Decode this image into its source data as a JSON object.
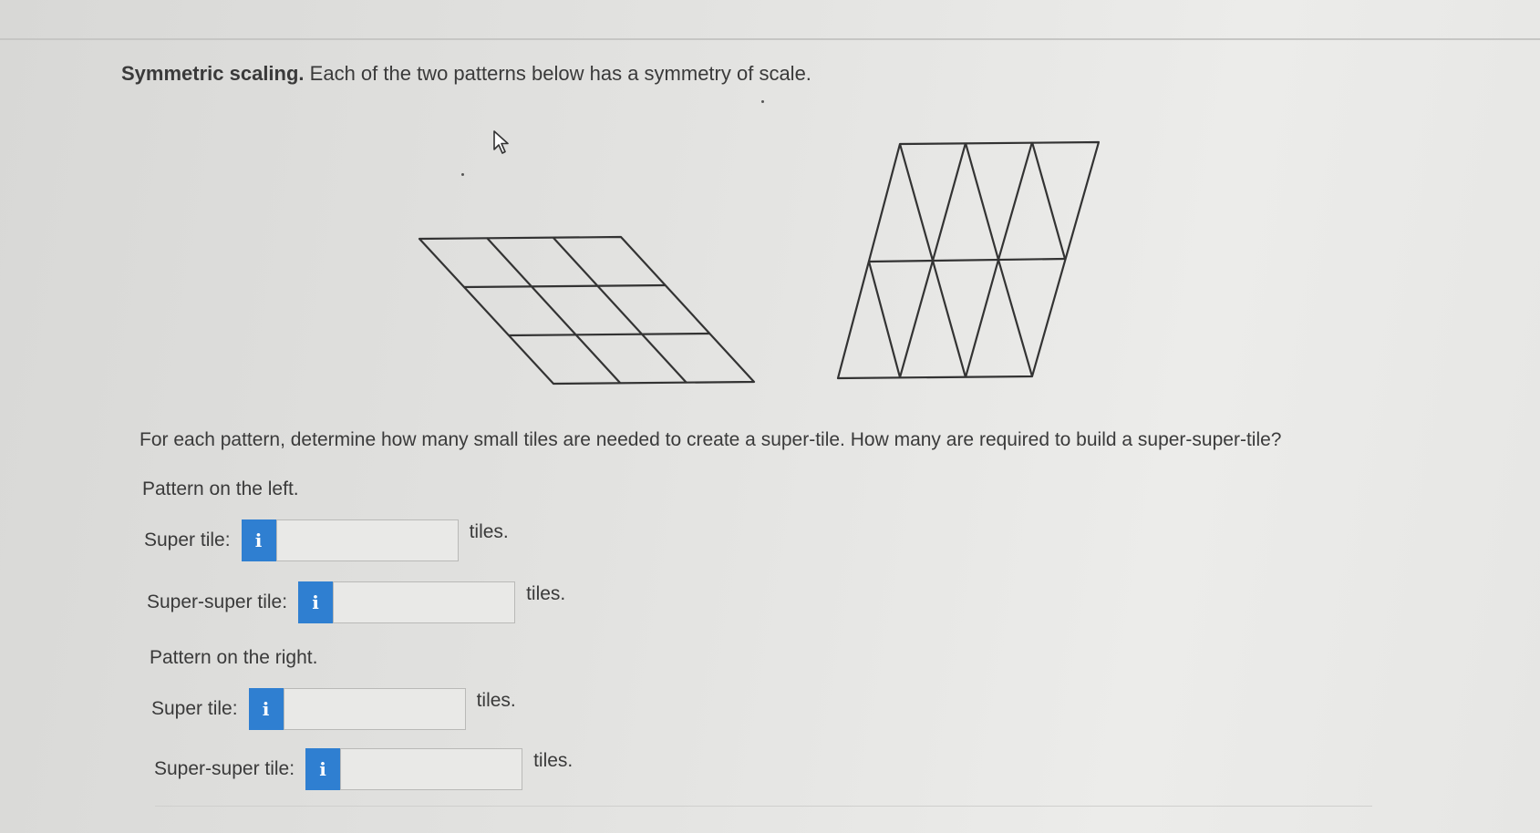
{
  "problem": {
    "title_bold": "Symmetric scaling.",
    "title_rest": " Each of the two patterns below has a symmetry of scale.",
    "instruction": "For each pattern, determine how many small tiles are needed to create a super-tile. How many are required to build a super-super-tile?"
  },
  "figures": {
    "left_pattern": "parallelogram-grid-3x3",
    "right_pattern": "triangle-tiling-3x2"
  },
  "left_section": {
    "label": "Pattern on the left.",
    "super_tile": {
      "label": "Super tile:",
      "value": "",
      "unit": "tiles."
    },
    "super_super_tile": {
      "label": "Super-super tile:",
      "value": "",
      "unit": "tiles."
    }
  },
  "right_section": {
    "label": "Pattern on the right.",
    "super_tile": {
      "label": "Super tile:",
      "value": "",
      "unit": "tiles."
    },
    "super_super_tile": {
      "label": "Super-super tile:",
      "value": "",
      "unit": "tiles."
    }
  },
  "info_icon": {
    "name": "info-icon",
    "glyph": "i",
    "color": "#2f7fd1"
  }
}
